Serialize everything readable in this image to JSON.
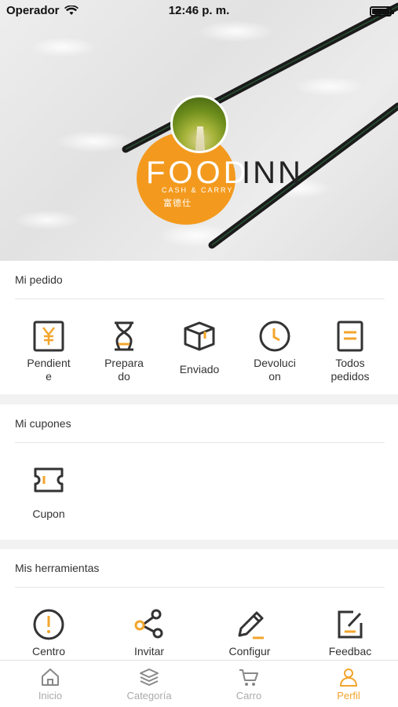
{
  "status_bar": {
    "carrier": "Operador",
    "time": "12:46 p. m."
  },
  "brand": {
    "name_left": "FOOD",
    "name_right": "INN",
    "tagline": "CASH & CARRY",
    "chinese": "富德仕",
    "accent": "#f39a1e"
  },
  "orders": {
    "title": "Mi pedido",
    "items": [
      {
        "label": "Pendient\ne",
        "icon": "yen-receipt-icon"
      },
      {
        "label": "Prepara\ndo",
        "icon": "hourglass-icon"
      },
      {
        "label": "Enviado",
        "icon": "box-icon"
      },
      {
        "label": "Devoluci\non",
        "icon": "clock-icon"
      },
      {
        "label": "Todos\npedidos",
        "icon": "document-icon"
      }
    ]
  },
  "coupons": {
    "title": "Mi cupones",
    "items": [
      {
        "label": "Cupon",
        "icon": "ticket-icon"
      }
    ]
  },
  "tools": {
    "title": "Mis herramientas",
    "items": [
      {
        "label": "Centro",
        "icon": "alert-icon"
      },
      {
        "label": "Invitar",
        "icon": "share-icon"
      },
      {
        "label": "Configur",
        "icon": "pencil-icon"
      },
      {
        "label": "Feedbac",
        "icon": "feedback-icon"
      }
    ]
  },
  "tabbar": {
    "items": [
      {
        "label": "Inicio",
        "icon": "home-icon"
      },
      {
        "label": "Categoría",
        "icon": "layers-icon"
      },
      {
        "label": "Carro",
        "icon": "cart-icon"
      },
      {
        "label": "Perfil",
        "icon": "person-icon"
      }
    ],
    "active": "Perfil",
    "active_color": "#f3a52b",
    "inactive_color": "#aaaaaa"
  }
}
